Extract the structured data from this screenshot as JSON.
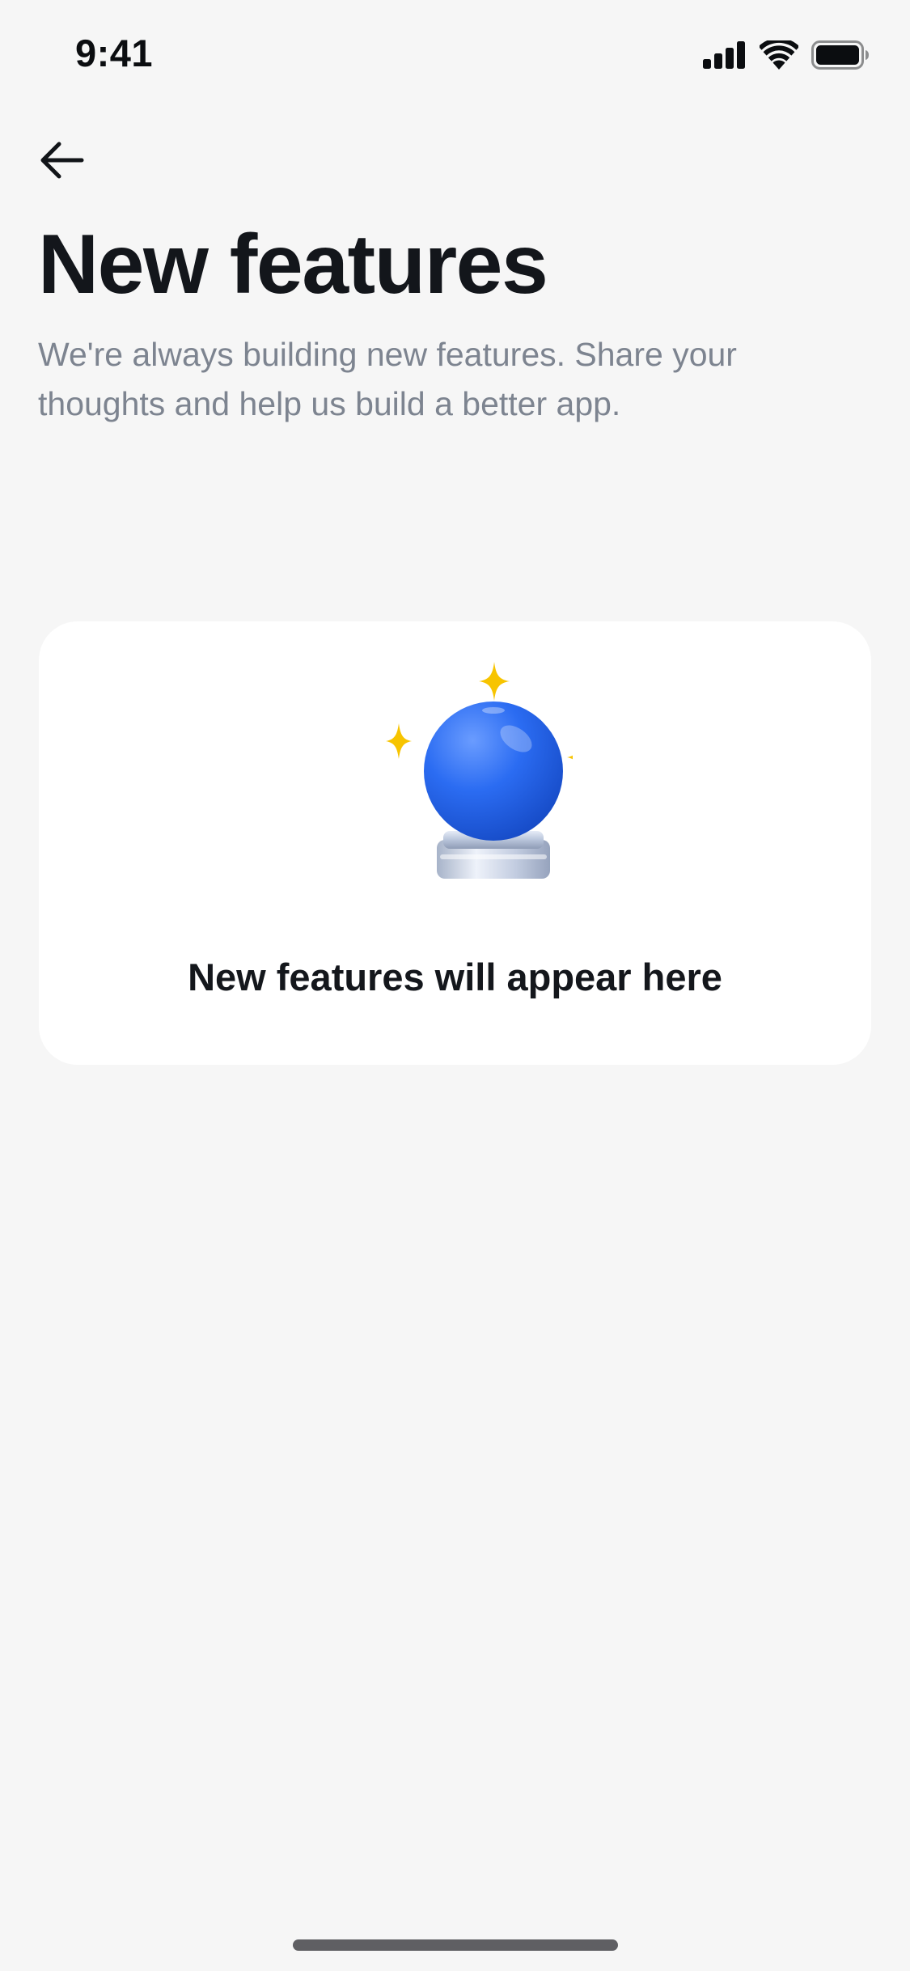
{
  "status_bar": {
    "time": "9:41",
    "icons": [
      "cellular-signal-icon",
      "wifi-icon",
      "battery-icon"
    ]
  },
  "header": {
    "back_icon": "arrow-left-icon",
    "title": "New features",
    "subtitle": "We're always building new features. Share your thoughts and help us build a better app."
  },
  "empty_state": {
    "illustration": "crystal-ball-with-sparkles-icon",
    "message": "New features will appear here"
  },
  "colors": {
    "background": "#f6f6f6",
    "card": "#ffffff",
    "title": "#13161b",
    "subtitle": "#7d8490",
    "sparkle": "#f7c400",
    "ball": "#2f6ff0"
  }
}
